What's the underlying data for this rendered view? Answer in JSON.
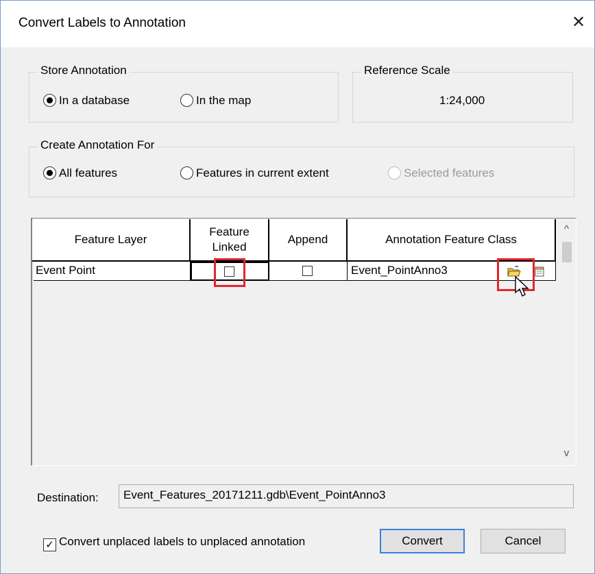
{
  "window": {
    "title": "Convert Labels to Annotation",
    "close_symbol": "✕"
  },
  "store_annotation": {
    "label": "Store Annotation",
    "options": [
      {
        "label": "In a database",
        "selected": true
      },
      {
        "label": "In the map",
        "selected": false
      }
    ]
  },
  "reference_scale": {
    "label": "Reference Scale",
    "value": "1:24,000"
  },
  "create_annotation_for": {
    "label": "Create Annotation For",
    "options": [
      {
        "label": "All features",
        "selected": true
      },
      {
        "label": "Features in current extent",
        "selected": false
      },
      {
        "label": "Selected features",
        "selected": false,
        "disabled": true
      }
    ]
  },
  "table": {
    "headers": [
      "Feature Layer",
      "Feature\nLinked",
      "Append",
      "Annotation Feature Class"
    ],
    "rows": [
      {
        "feature_layer": "Event Point",
        "feature_linked": false,
        "append": false,
        "annotation_feature_class": "Event_PointAnno3"
      }
    ],
    "scroll_up": "^",
    "scroll_down": "v"
  },
  "destination": {
    "label": "Destination:",
    "value": "Event_Features_20171211.gdb\\Event_PointAnno3"
  },
  "convert_unplaced": {
    "label": "Convert unplaced labels to unplaced annotation",
    "checked": true,
    "check_mark": "✓"
  },
  "buttons": {
    "convert": "Convert",
    "cancel": "Cancel"
  },
  "colors": {
    "highlight": "#e0262c",
    "accent": "#3c7fd6"
  },
  "icons": [
    "browse-folder-icon",
    "properties-icon",
    "mouse-cursor-icon"
  ]
}
